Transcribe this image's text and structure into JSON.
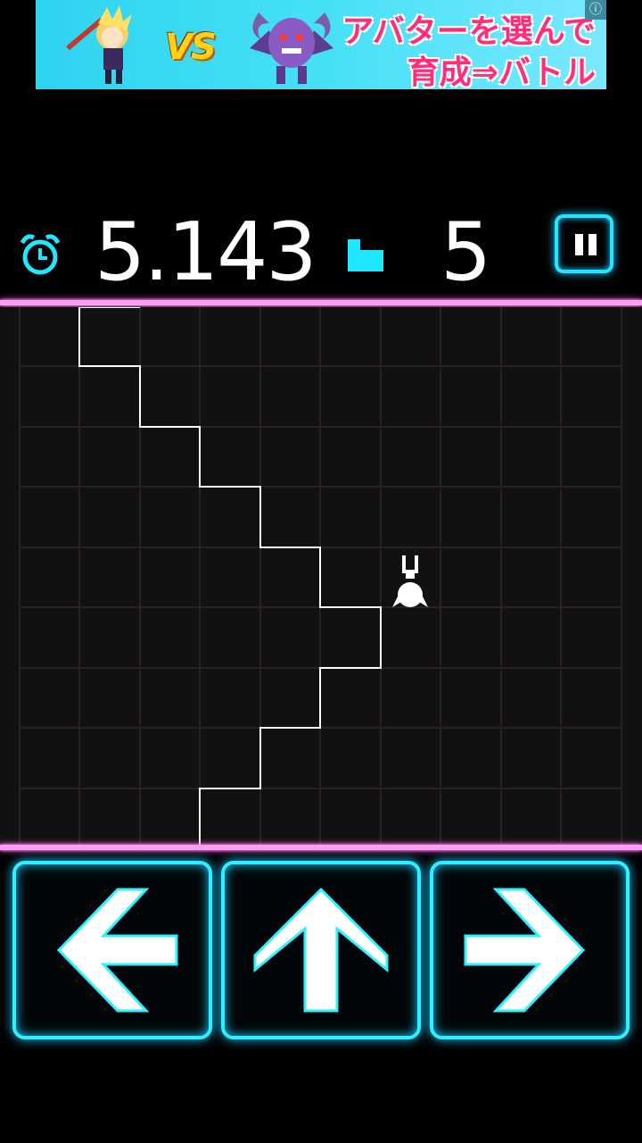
{
  "ad": {
    "vs_text": "VS",
    "line1": "アバターを選んで",
    "line2": "育成⇒バトル",
    "info_icon": "info-icon"
  },
  "hud": {
    "timer_icon": "alarm-clock-icon",
    "time": "5.143",
    "steps_icon": "stairs-icon",
    "steps": "5",
    "pause_icon": "pause-icon"
  },
  "colors": {
    "neon_cyan": "#2ff0ff",
    "neon_pink": "#ff9cf6",
    "background": "#000000"
  },
  "controls": {
    "left_icon": "arrow-left-icon",
    "up_icon": "arrow-up-icon",
    "right_icon": "arrow-right-icon"
  }
}
